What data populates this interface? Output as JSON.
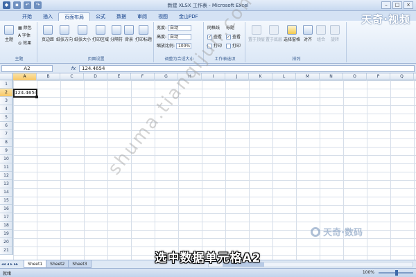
{
  "window": {
    "title": "新建 XLSX 工作表 - Microsoft Excel",
    "controls": [
      "–",
      "□",
      "×"
    ]
  },
  "ribbon": {
    "tabs": [
      "开始",
      "插入",
      "页面布局",
      "公式",
      "数据",
      "审阅",
      "视图",
      "金山PDF"
    ],
    "active_tab": "页面布局",
    "groups": {
      "theme": {
        "label": "主题",
        "theme_button": "主题",
        "colors": "颜色",
        "fonts": "字体",
        "effects": "效果"
      },
      "page_setup": {
        "label": "页面设置",
        "buttons": [
          "页边距",
          "纸张方向",
          "纸张大小",
          "打印区域",
          "分隔符",
          "背景",
          "打印标题"
        ]
      },
      "scale": {
        "label": "调整为合适大小",
        "width_label": "宽度:",
        "width_value": "自动",
        "height_label": "高度:",
        "height_value": "自动",
        "zoom_label": "缩放比例:",
        "zoom_value": "100%"
      },
      "sheet_options": {
        "label": "工作表选项",
        "gridlines": "网格线",
        "headings": "标题",
        "view": "查看",
        "print": "打印"
      },
      "arrange": {
        "label": "排列",
        "buttons": [
          "置于顶层",
          "置于底层",
          "选择窗格",
          "对齐",
          "组合",
          "旋转"
        ]
      }
    }
  },
  "formula_bar": {
    "name_box": "A2",
    "fx": "fx",
    "value": "124.4654"
  },
  "grid": {
    "columns": [
      "A",
      "B",
      "C",
      "D",
      "E",
      "F",
      "G",
      "H",
      "I",
      "J",
      "K",
      "L",
      "M",
      "N",
      "O",
      "P",
      "Q"
    ],
    "rows": [
      "1",
      "2",
      "3",
      "4",
      "5",
      "6",
      "7",
      "8",
      "9",
      "10",
      "11",
      "12",
      "13",
      "14",
      "15",
      "16",
      "17",
      "18",
      "19",
      "20",
      "21"
    ],
    "selected_column": "A",
    "selected_row": "2",
    "active_cell_value": "124.4654"
  },
  "sheets": {
    "nav": [
      "◂◂",
      "◂",
      "▸",
      "▸▸"
    ],
    "tabs": [
      "Sheet1",
      "Sheet2",
      "Sheet3"
    ],
    "active": "Sheet1"
  },
  "status": {
    "ready": "就绪",
    "zoom": "100%"
  },
  "overlay": {
    "brand_top": "天奇·视频",
    "watermark": "shuma.tianqijun.com",
    "brand_bottom": "天奇·数码",
    "caption": "选中数据单元格A2"
  }
}
